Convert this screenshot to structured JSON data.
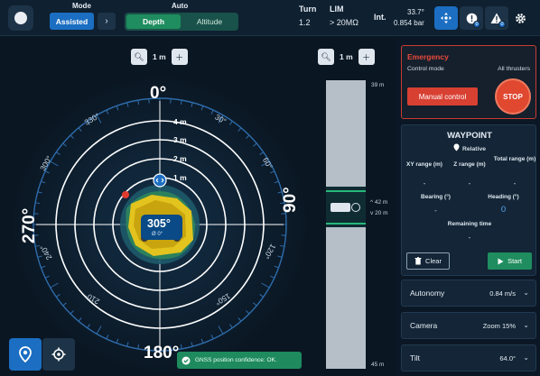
{
  "topbar": {
    "mode_label": "Mode",
    "mode_value": "Assisted",
    "auto_label": "Auto",
    "auto_tabs": [
      "Depth",
      "Altitude"
    ],
    "turn_label": "Turn",
    "turn_value": "1.2",
    "lim_label": "LIM",
    "lim_value": "> 20MΩ",
    "int_label": "Int.",
    "int_temp": "33.7°",
    "int_pressure": "0.854 bar",
    "badge_info": "0",
    "badge_warn": "0"
  },
  "map": {
    "zoom_label_left": "1 m",
    "zoom_label_right": "1 m",
    "heading_value": "305°",
    "heading_sub": "Ø 0°",
    "cardinal": {
      "n": "0°",
      "e": "90°",
      "s": "180°",
      "w": "270°"
    },
    "ring_labels": [
      "4 m",
      "3 m",
      "2 m",
      "1 m"
    ],
    "degree_labels": [
      "30°",
      "60°",
      "120°",
      "150°",
      "210°",
      "240°",
      "300°",
      "330°"
    ],
    "depth": {
      "top": "39 m",
      "bottom": "45 m",
      "mark1": "42 m",
      "mark2": "20 m"
    },
    "gnss_text": "GNSS position confidence: OK."
  },
  "emergency": {
    "title": "Emergency",
    "control_mode_label": "Control mode",
    "all_thrusters_label": "All thrusters",
    "manual_button": "Manual control",
    "stop_button": "STOP"
  },
  "waypoint": {
    "title": "WAYPOINT",
    "relative_label": "Relative",
    "xy_range_label": "XY range (m)",
    "z_range_label": "Z range (m)",
    "total_range_label": "Total range (m)",
    "xy_range_value": "-",
    "z_range_value": "-",
    "total_range_value": "-",
    "bearing_label": "Bearing (°)",
    "heading_label": "Heading (°)",
    "bearing_value": "-",
    "heading_value": "0",
    "remaining_label": "Remaining time",
    "remaining_value": "-",
    "clear_button": "Clear",
    "start_button": "Start"
  },
  "settings": [
    {
      "label": "Autonomy",
      "value": "0.84 m/s"
    },
    {
      "label": "Camera",
      "value": "Zoom 15%"
    },
    {
      "label": "Tilt",
      "value": "64.0°"
    }
  ],
  "colors": {
    "accent": "#1b6ec2",
    "success": "#1f8d5f",
    "danger": "#e04830"
  }
}
